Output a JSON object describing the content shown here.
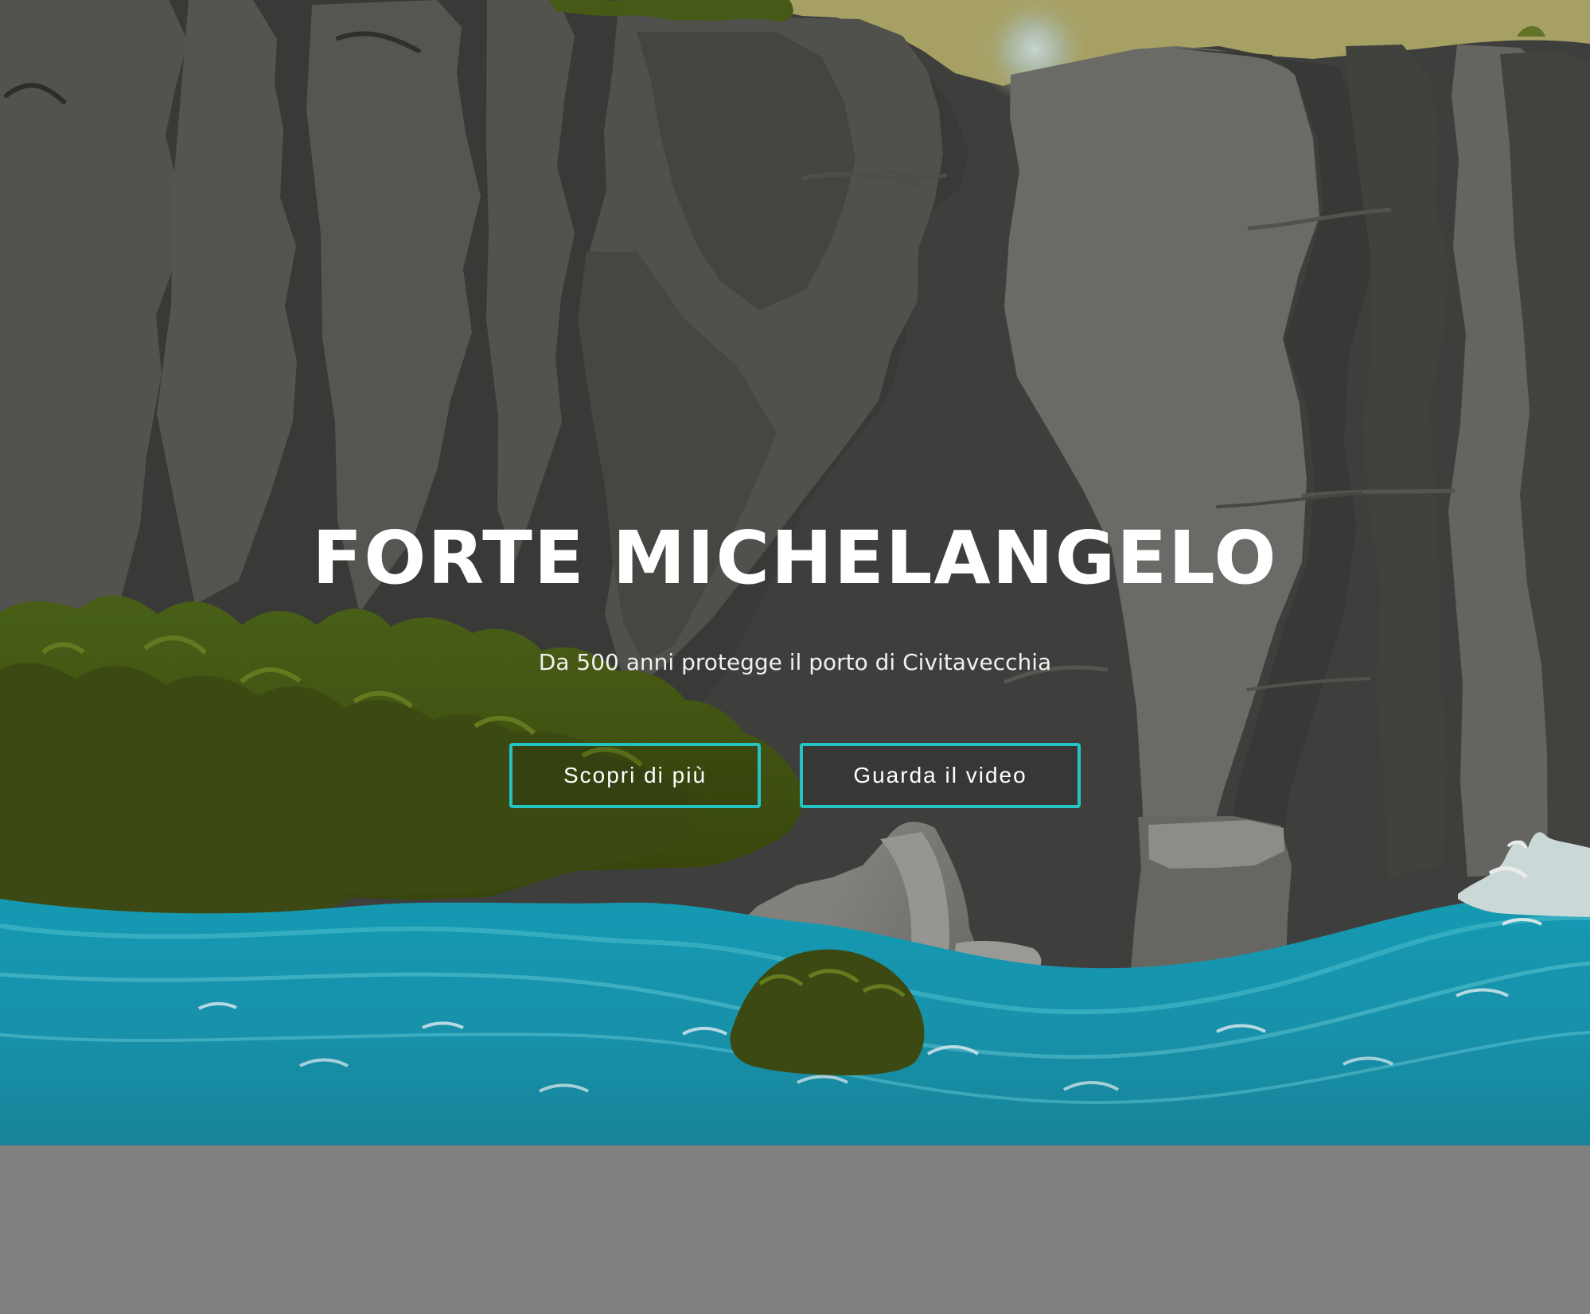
{
  "hero": {
    "title": "FORTE MICHELANGELO",
    "subtitle": "Da 500 anni protegge il porto di Civitavecchia",
    "buttons": {
      "more_label": "Scopri di più",
      "video_label": "Guarda il video"
    }
  },
  "colors": {
    "accent": "#25c4c4",
    "footer_background": "#808080",
    "text": "#ffffff",
    "water": "#1ea4c2"
  }
}
